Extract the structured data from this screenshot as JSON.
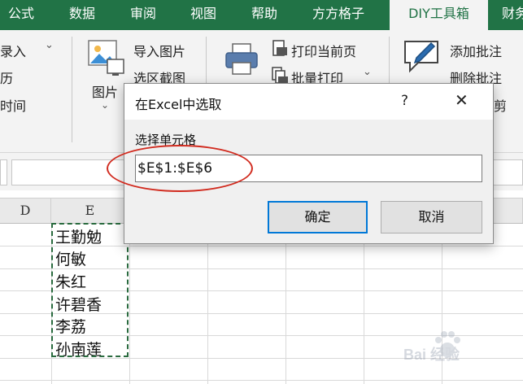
{
  "ribbon": {
    "tabs": [
      "公式",
      "数据",
      "审阅",
      "视图",
      "帮助",
      "方方格子",
      "DIY工具箱",
      "财务"
    ],
    "active_tab": "DIY工具箱",
    "left_items": [
      "录入",
      "历",
      "时间"
    ],
    "picture_group": {
      "big_label": "图片",
      "items": [
        "导入图片",
        "选区截图"
      ]
    },
    "print_group": {
      "items": [
        "打印当前页",
        "批量打印"
      ]
    },
    "comment_group": {
      "items": [
        "添加批注",
        "删除批注"
      ],
      "partial": "剪"
    },
    "accent_color": "#217346"
  },
  "grid": {
    "columns": [
      "D",
      "E"
    ],
    "cells_e": [
      "王勤勉",
      "何敏",
      "朱红",
      "许碧香",
      "李荔",
      "孙南莲"
    ]
  },
  "dialog": {
    "title": "在Excel中选取",
    "help_label": "?",
    "close_label": "✕",
    "prompt": "选择单元格",
    "input_value": "$E$1:$E$6",
    "ok_label": "确定",
    "cancel_label": "取消"
  },
  "annotation": {
    "color": "#d12b1f"
  },
  "watermark": {
    "text": "Bai 经验"
  }
}
